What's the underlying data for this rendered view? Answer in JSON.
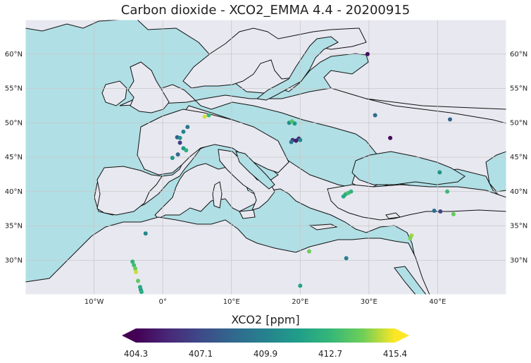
{
  "title": "Carbon dioxide - XCO2_EMMA 4.4 - 20200915",
  "map": {
    "extent": {
      "lon": [
        -20,
        50
      ],
      "lat": [
        25,
        65
      ]
    },
    "ocean_color": "#b0dfe5",
    "land_color": "#e8e8f0",
    "lat_ticks_left": [
      "60°N",
      "55°N",
      "50°N",
      "45°N",
      "40°N",
      "35°N",
      "30°N"
    ],
    "lat_ticks_right": [
      "60°N",
      "55°N",
      "50°N",
      "45°N",
      "40°N",
      "35°N",
      "30°N"
    ],
    "lon_ticks": [
      "10°W",
      "0°",
      "10°E",
      "20°E",
      "30°E",
      "40°E"
    ]
  },
  "colorbar": {
    "label": "XCO2 [ppm]",
    "colormap": "viridis",
    "min": 404.3,
    "max": 415.4,
    "ticks": [
      "404.3",
      "407.1",
      "409.9",
      "412.7",
      "415.4"
    ]
  },
  "points": [
    {
      "lon": 29.8,
      "lat": 60.0,
      "v": 404.8
    },
    {
      "lon": 30.9,
      "lat": 51.1,
      "v": 408.8
    },
    {
      "lon": 41.8,
      "lat": 50.5,
      "v": 408.3
    },
    {
      "lon": 33.1,
      "lat": 47.8,
      "v": 404.6
    },
    {
      "lon": 40.3,
      "lat": 42.8,
      "v": 410.6
    },
    {
      "lon": 41.4,
      "lat": 40.0,
      "v": 412.8
    },
    {
      "lon": 39.5,
      "lat": 37.2,
      "v": 408.8
    },
    {
      "lon": 40.4,
      "lat": 37.1,
      "v": 406.8
    },
    {
      "lon": 42.3,
      "lat": 36.7,
      "v": 413.8
    },
    {
      "lon": 36.2,
      "lat": 33.6,
      "v": 414.5
    },
    {
      "lon": 36.0,
      "lat": 33.2,
      "v": 414.2
    },
    {
      "lon": 26.6,
      "lat": 39.6,
      "v": 412.2
    },
    {
      "lon": 27.0,
      "lat": 39.8,
      "v": 413.0
    },
    {
      "lon": 27.4,
      "lat": 40.0,
      "v": 412.4
    },
    {
      "lon": 26.3,
      "lat": 39.3,
      "v": 411.8
    },
    {
      "lon": 21.3,
      "lat": 31.3,
      "v": 414.0
    },
    {
      "lon": 26.7,
      "lat": 30.3,
      "v": 409.8
    },
    {
      "lon": 20.0,
      "lat": 26.3,
      "v": 411.5
    },
    {
      "lon": 18.4,
      "lat": 50.0,
      "v": 410.4
    },
    {
      "lon": 18.8,
      "lat": 50.2,
      "v": 413.4
    },
    {
      "lon": 19.2,
      "lat": 49.9,
      "v": 411.2
    },
    {
      "lon": 18.9,
      "lat": 47.5,
      "v": 406.0
    },
    {
      "lon": 19.4,
      "lat": 47.4,
      "v": 405.2
    },
    {
      "lon": 19.8,
      "lat": 47.7,
      "v": 405.8
    },
    {
      "lon": 18.7,
      "lat": 47.2,
      "v": 409.2
    },
    {
      "lon": 20.0,
      "lat": 47.5,
      "v": 410.2
    },
    {
      "lon": 6.1,
      "lat": 50.9,
      "v": 415.0
    },
    {
      "lon": 6.7,
      "lat": 51.1,
      "v": 412.6
    },
    {
      "lon": 3.6,
      "lat": 49.4,
      "v": 409.2
    },
    {
      "lon": 3.0,
      "lat": 48.7,
      "v": 409.9
    },
    {
      "lon": 2.1,
      "lat": 47.9,
      "v": 408.0
    },
    {
      "lon": 2.5,
      "lat": 47.8,
      "v": 410.6
    },
    {
      "lon": 2.5,
      "lat": 47.1,
      "v": 406.6
    },
    {
      "lon": 3.0,
      "lat": 46.3,
      "v": 411.0
    },
    {
      "lon": 3.4,
      "lat": 46.0,
      "v": 412.3
    },
    {
      "lon": 2.2,
      "lat": 45.4,
      "v": 408.5
    },
    {
      "lon": 1.4,
      "lat": 44.9,
      "v": 410.7
    },
    {
      "lon": -2.5,
      "lat": 33.9,
      "v": 410.2
    },
    {
      "lon": -4.4,
      "lat": 29.8,
      "v": 412.3
    },
    {
      "lon": -4.2,
      "lat": 29.3,
      "v": 412.9
    },
    {
      "lon": -4.0,
      "lat": 28.8,
      "v": 413.9
    },
    {
      "lon": -3.9,
      "lat": 28.3,
      "v": 414.9
    },
    {
      "lon": -3.6,
      "lat": 27.0,
      "v": 413.6
    },
    {
      "lon": -3.3,
      "lat": 26.1,
      "v": 411.9
    },
    {
      "lon": -3.2,
      "lat": 25.7,
      "v": 411.4
    },
    {
      "lon": -3.1,
      "lat": 25.4,
      "v": 412.0
    }
  ]
}
